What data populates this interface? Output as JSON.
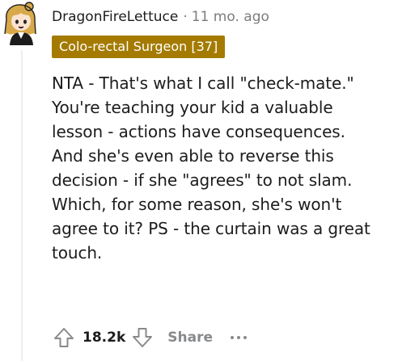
{
  "comment": {
    "author": "DragonFireLettuce",
    "separator": "·",
    "time": "11 mo. ago",
    "flair": "Colo-rectal Surgeon [37]",
    "flair_color": "#a47b00",
    "avatar_icon": "cartoon-avatar-icon",
    "body_lines": [
      "NTA - That's what I call \"check-mate.\"",
      "You're teaching your kid a valuable",
      "lesson - actions have consequences.",
      "And she's even able to reverse this",
      "decision - if she \"agrees\" to not slam.",
      "Which, for some reason, she's won't",
      "agree to it? PS - the curtain was a great",
      "touch."
    ],
    "score": "18.2k",
    "share_label": "Share",
    "upvote_icon": "upvote-arrow-icon",
    "downvote_icon": "downvote-arrow-icon",
    "more_icon": "more-options-icon"
  }
}
